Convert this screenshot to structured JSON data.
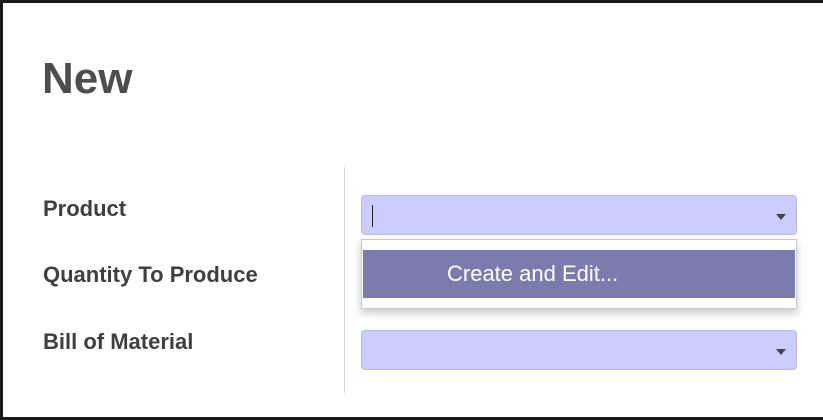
{
  "form": {
    "title": "New",
    "labels": {
      "product": "Product",
      "quantity": "Quantity To Produce",
      "bom": "Bill of Material"
    },
    "fields": {
      "product": {
        "value": "",
        "icon": "dropdown-arrow"
      },
      "bom": {
        "value": "",
        "icon": "dropdown-arrow"
      }
    }
  },
  "dropdown": {
    "items": [
      {
        "label": "Create and Edit..."
      }
    ]
  },
  "colors": {
    "field_bg": "#ccccff",
    "menu_highlight": "#7c7bad",
    "title": "#4d4d4d",
    "label": "#3f3f3f"
  }
}
